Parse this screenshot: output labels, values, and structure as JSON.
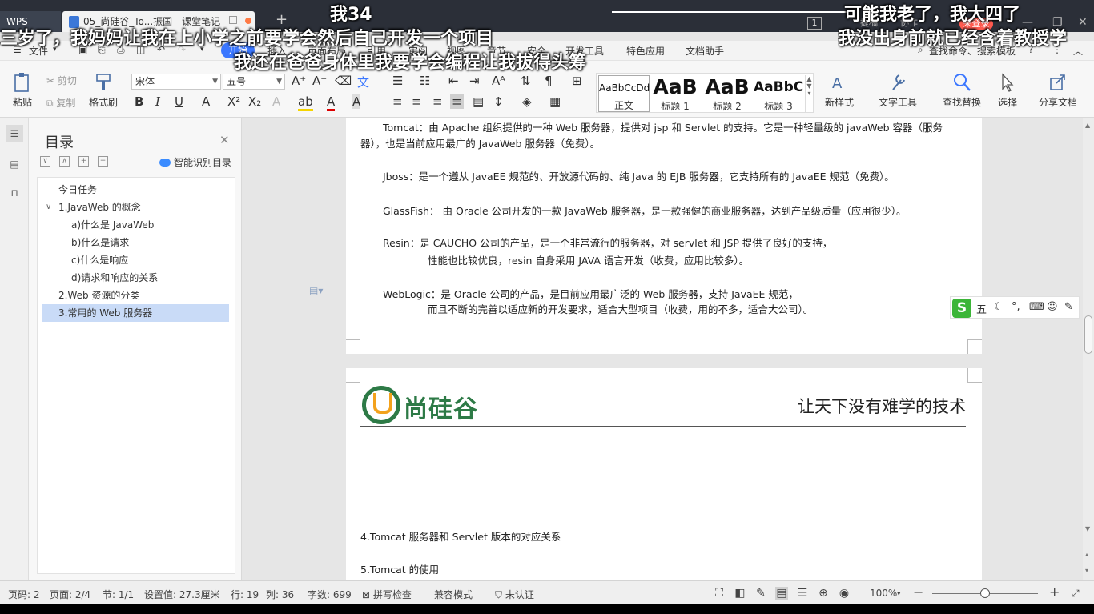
{
  "titlebar": {
    "wps_tab": "WPS",
    "doc_tab": "05_尚硅谷_To...振国 - 课堂笔记",
    "add_tab": "+",
    "badge": "1",
    "right_text_a": "捷稿",
    "right_text_b": "协作",
    "login": "未登录",
    "min": "—",
    "restore": "❐",
    "close": "✕"
  },
  "menu": {
    "file": "文件",
    "start": "开始",
    "items": [
      "插入",
      "页面布局",
      "引用",
      "审阅",
      "视图",
      "章节",
      "安全",
      "开发工具",
      "特色应用",
      "文档助手"
    ],
    "search": "查找命令、搜索模板",
    "help": "?",
    "more": "⋮",
    "collapse": "︿"
  },
  "ribbon": {
    "paste": "粘贴",
    "cut": "剪切",
    "copy": "复制",
    "format_painter": "格式刷",
    "font_name": "宋体",
    "font_size": "五号",
    "styles": [
      {
        "preview": "AaBbCcDd",
        "label": "正文"
      },
      {
        "preview": "AaB",
        "label": "标题 1"
      },
      {
        "preview": "AaB",
        "label": "标题 2"
      },
      {
        "preview": "AaBbC(",
        "label": "标题 3"
      }
    ],
    "new_style": "新样式",
    "text_tools": "文字工具",
    "find_replace": "查找替换",
    "select": "选择",
    "share": "分享文档"
  },
  "nav": {
    "title": "目录",
    "smart": "智能识别目录",
    "items": [
      {
        "label": "今日任务",
        "level": 0
      },
      {
        "label": "1.JavaWeb 的概念",
        "level": 0,
        "expanded": true
      },
      {
        "label": "a)什么是 JavaWeb",
        "level": 1
      },
      {
        "label": "b)什么是请求",
        "level": 1
      },
      {
        "label": "c)什么是响应",
        "level": 1
      },
      {
        "label": "d)请求和响应的关系",
        "level": 1
      },
      {
        "label": "2.Web 资源的分类",
        "level": 0
      },
      {
        "label": "3.常用的 Web 服务器",
        "level": 0,
        "selected": true
      }
    ]
  },
  "doc": {
    "tomcat_1": "Tomcat：由 Apache 组织提供的一种 Web 服务器，提供对 jsp 和 Servlet 的支持。它是一种轻量级的 javaWeb 容器（服务",
    "tomcat_2": "器），也是当前应用最广的 JavaWeb 服务器（免费）。",
    "jboss": "Jboss：是一个遵从 JavaEE 规范的、开放源代码的、纯 Java 的 EJB 服务器，它支持所有的 JavaEE 规范（免费）。",
    "glassfish": "GlassFish： 由 Oracle 公司开发的一款 JavaWeb 服务器，是一款强健的商业服务器，达到产品级质量（应用很少）。",
    "resin_1": "Resin：是 CAUCHO 公司的产品，是一个非常流行的服务器，对 servlet 和 JSP 提供了良好的支持，",
    "resin_2": "性能也比较优良，resin 自身采用 JAVA 语言开发（收费，应用比较多）。",
    "weblogic_1": "WebLogic：是 Oracle 公司的产品，是目前应用最广泛的 Web 服务器，支持 JavaEE 规范，",
    "weblogic_2": "而且不断的完善以适应新的开发要求，适合大型项目（收费，用的不多，适合大公司）。",
    "logo": "尚硅谷",
    "slogan": "让天下没有难学的技术",
    "sec4": "4.Tomcat 服务器和 Servlet 版本的对应关系",
    "sec5": "5.Tomcat 的使用"
  },
  "ime": {
    "logo": "S",
    "mode": "五"
  },
  "status": {
    "page_no": "页码: 2",
    "pages": "页面: 2/4",
    "section": "节: 1/1",
    "setting": "设置值: 27.3厘米",
    "row": "行: 19",
    "col": "列: 36",
    "words": "字数: 699",
    "spell": "拼写检查",
    "compat": "兼容模式",
    "cert": "未认证",
    "zoom": "100%",
    "zoom_level": 0.5
  },
  "danmaku": [
    {
      "text": "我34"
    },
    {
      "text": "可能我老了，我大四了"
    },
    {
      "text": "三岁了，我妈妈让我在上小学之前要学会然后自己开发一个项目"
    },
    {
      "text": "我没出身前就已经含着教授学"
    },
    {
      "text": "我还在爸爸身体里我要学会编程让我拔得头筹"
    }
  ]
}
